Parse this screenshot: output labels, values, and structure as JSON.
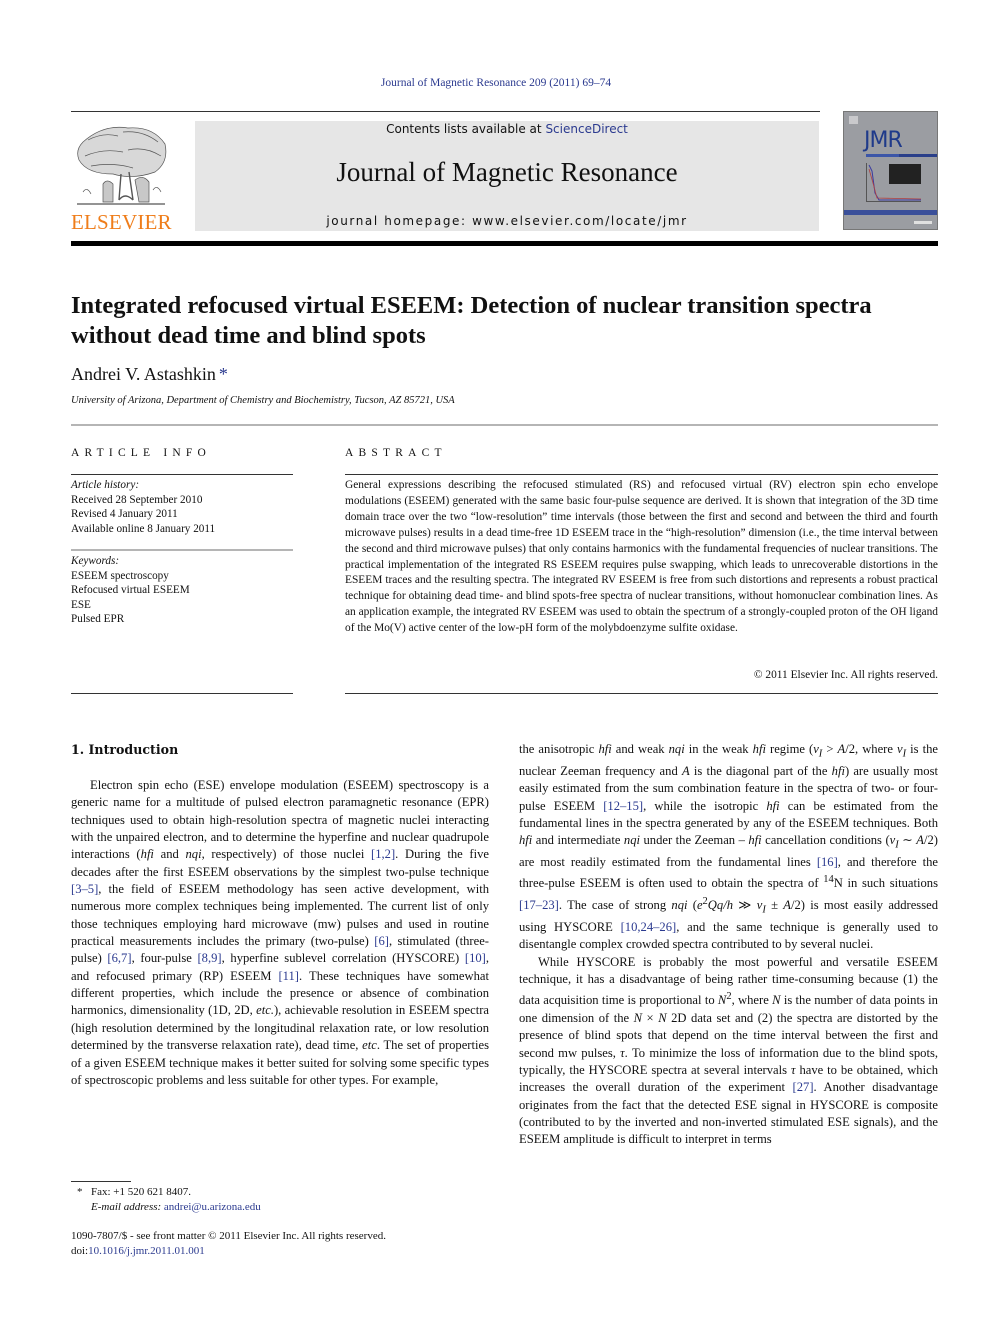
{
  "header": {
    "running_head": "Journal of Magnetic Resonance 209 (2011) 69–74",
    "contents_prefix": "Contents lists available at ",
    "contents_link": "ScienceDirect",
    "journal_title": "Journal of Magnetic Resonance",
    "homepage": "journal homepage: www.elsevier.com/locate/jmr",
    "publisher_logo_text": "ELSEVIER",
    "cover_abbrev": "JMR",
    "colors": {
      "link": "#2b3a8f",
      "publisher_orange": "#ef7d1a",
      "masthead_bg": "#e6e6e6"
    }
  },
  "article": {
    "title": "Integrated refocused virtual ESEEM: Detection of nuclear transition spectra without dead time and blind spots",
    "author": "Andrei V. Astashkin",
    "author_mark": "*",
    "affiliation": "University of Arizona, Department of Chemistry and Biochemistry, Tucson, AZ 85721, USA"
  },
  "article_info": {
    "label": "ARTICLE INFO",
    "history_label": "Article history:",
    "history": [
      "Received 28 September 2010",
      "Revised 4 January 2011",
      "Available online 8 January 2011"
    ],
    "keywords_label": "Keywords:",
    "keywords": [
      "ESEEM spectroscopy",
      "Refocused virtual ESEEM",
      "ESE",
      "Pulsed EPR"
    ]
  },
  "abstract": {
    "label": "ABSTRACT",
    "text": "General expressions describing the refocused stimulated (RS) and refocused virtual (RV) electron spin echo envelope modulations (ESEEM) generated with the same basic four-pulse sequence are derived. It is shown that integration of the 3D time domain trace over the two “low-resolution” time intervals (those between the first and second and between the third and fourth microwave pulses) results in a dead time-free 1D ESEEM trace in the “high-resolution” dimension (i.e., the time interval between the second and third microwave pulses) that only contains harmonics with the fundamental frequencies of nuclear transitions. The practical implementation of the integrated RS ESEEM requires pulse swapping, which leads to unrecoverable distortions in the ESEEM traces and the resulting spectra. The integrated RV ESEEM is free from such distortions and represents a robust practical technique for obtaining dead time- and blind spots-free spectra of nuclear transitions, without homonuclear combination lines. As an application example, the integrated RV ESEEM was used to obtain the spectrum of a strongly-coupled proton of the OH ligand of the Mo(V) active center of the low-pH form of the molybdoenzyme sulfite oxidase.",
    "copyright": "© 2011 Elsevier Inc. All rights reserved."
  },
  "body": {
    "section_heading": "1. Introduction",
    "left_column": {
      "p1_a": "Electron spin echo (ESE) envelope modulation (ESEEM) spectroscopy is a generic name for a multitude of pulsed electron paramagnetic resonance (EPR) techniques used to obtain high-resolution spectra of magnetic nuclei interacting with the unpaired electron, and to determine the hyperfine and nuclear quadrupole interactions (",
      "hfi": "hfi",
      "and": " and ",
      "nqi": "nqi",
      "p1_b": ", respectively) of those nuclei ",
      "ref_1_2": "[1,2]",
      "p1_c": ". During the five decades after the first ESEEM observations by the simplest two-pulse technique ",
      "ref_3_5": "[3–5]",
      "p1_d": ", the field of ESEEM methodology has seen active development, with numerous more complex techniques being implemented. The current list of only those techniques employing hard microwave (mw) pulses and used in routine practical measurements includes the primary (two-pulse) ",
      "ref_6": "[6]",
      "p1_e": ", stimulated (three-pulse) ",
      "ref_6_7": "[6,7]",
      "p1_f": ", four-pulse ",
      "ref_8_9": "[8,9]",
      "p1_g": ", hyperfine sublevel correlation (HYSCORE) ",
      "ref_10": "[10]",
      "p1_h": ", and refocused primary (RP) ESEEM ",
      "ref_11": "[11]",
      "p1_i": ". These techniques have somewhat different properties, which include the presence or absence of combination harmonics, dimensionality (1D, 2D, ",
      "etc1": "etc.",
      "p1_j": "), achievable resolution in ESEEM spectra (high resolution determined by the longitudinal relaxation rate, or low resolution determined by the transverse relaxation rate), dead time, ",
      "etc2": "etc",
      "p1_k": ". The set of properties of a given ESEEM technique makes it better suited for solving some specific types of spectroscopic problems and less suitable for other types. For example,"
    },
    "right_column": {
      "p1_a": "the anisotropic ",
      "hfi": "hfi",
      "p1_b": " and weak ",
      "nqi": "nqi",
      "p1_c": " in the weak ",
      "p1_d": " regime (",
      "nu_i": "ν",
      "sub_i": "I",
      "p1_e": " > ",
      "a_half": "A",
      "p1_f": "/2, where ",
      "p1_g": " is the nuclear Zeeman frequency and ",
      "p1_h": " is the diagonal part of the ",
      "p1_i": ") are usually most easily estimated from the sum combination feature in the spectra of two- or four-pulse ESEEM ",
      "ref_12_15": "[12–15]",
      "p1_j": ", while the isotropic ",
      "p1_k": " can be estimated from the fundamental lines in the spectra generated by any of the ESEEM techniques. Both ",
      "p1_l": " and intermediate ",
      "p1_m": " under the Zeeman – ",
      "p1_n": " cancellation conditions (",
      "p1_o": " ∼ ",
      "p1_p": "/2) are most readily estimated from the fundamental lines ",
      "ref_16": "[16]",
      "p1_q": ", and therefore the three-pulse ESEEM is often used to obtain the spectra of ",
      "sup_14": "14",
      "p1_r": "N in such situations ",
      "ref_17_23": "[17–23]",
      "p1_s": ". The case of strong ",
      "p1_t": " (",
      "e2qq": "e",
      "sup_2": "2",
      "qq_h": "Qq/h",
      "p1_u": " ≫ ",
      "p1_v": " ± ",
      "p1_w": "/2) is most easily addressed using HYSCORE ",
      "ref_10_24_26": "[10,24–26]",
      "p1_x": ", and the same technique is generally used to disentangle complex crowded spectra contributed to by several nuclei.",
      "p2_a": "While HYSCORE is probably the most powerful and versatile ESEEM technique, it has a disadvantage of being rather time-consuming because (1) the data acquisition time is proportional to ",
      "n": "N",
      "p2_b": ", where ",
      "p2_c": " is the number of data points in one dimension of the ",
      "times": " × ",
      "p2_d": " 2D data set and (2) the spectra are distorted by the presence of blind spots that depend on the time interval between the first and second mw pulses, ",
      "tau": "τ",
      "p2_e": ". To minimize the loss of information due to the blind spots, typically, the HYSCORE spectra at several intervals ",
      "p2_f": " have to be obtained, which increases the overall duration of the experiment ",
      "ref_27": "[27]",
      "p2_g": ". Another disadvantage originates from the fact that the detected ESE signal in HYSCORE is composite (contributed to by the inverted and non-inverted stimulated ESE signals), and the ESEEM amplitude is difficult to interpret in terms"
    }
  },
  "footnotes": {
    "star": "*",
    "fax": "Fax: +1 520 621 8407.",
    "email_label": "E-mail address: ",
    "email": "andrei@u.arizona.edu",
    "frontmatter": "1090-7807/$ - see front matter © 2011 Elsevier Inc. All rights reserved.",
    "doi_prefix": "doi:",
    "doi": "10.1016/j.jmr.2011.01.001"
  }
}
